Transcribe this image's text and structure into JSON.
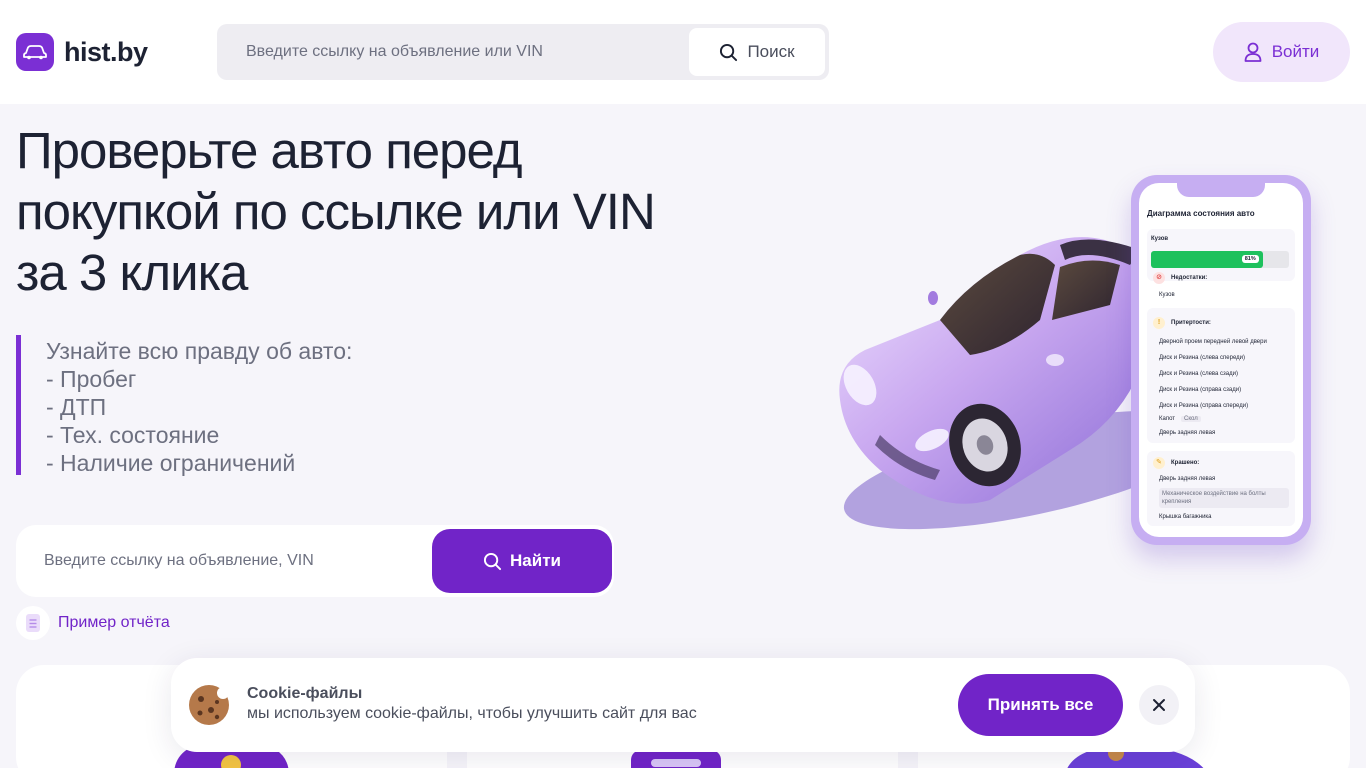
{
  "header": {
    "logo_text": "hist.by",
    "search_placeholder": "Введите ссылку на объявление или VIN",
    "search_button": "Поиск",
    "login_button": "Войти"
  },
  "hero": {
    "title_line1": "Проверьте авто перед",
    "title_line2": "покупкой по ссылке или VIN",
    "title_line3": "за 3 клика",
    "features": [
      "Узнайте всю правду об авто:",
      "- Пробег",
      "- ДТП",
      "- Тех. состояние",
      "- Наличие ограничений"
    ],
    "search_placeholder": "Введите ссылку на объявление, VIN",
    "find_button": "Найти",
    "sample_link": "Пример отчёта"
  },
  "phone": {
    "title": "Диаграмма состояния авто",
    "body_label": "Кузов",
    "body_percent": "81%",
    "body_fraction": 0.81,
    "defects_label": "Недостатки:",
    "defects_items": [
      "Кузов"
    ],
    "wear_label": "Притертости:",
    "wear_items": [
      "Дверной проем передней левой двери",
      "Диск и Резина (слева спереди)",
      "Диск и Резина (слева сзади)",
      "Диск и Резина (справа сзади)",
      "Диск и Резина (справа спереди)",
      "Капот",
      "Дверь задняя левая"
    ],
    "wear_tag": "Скол",
    "paint_label": "Крашено:",
    "paint_items": [
      "Дверь задняя левая",
      "Крышка багажника"
    ],
    "paint_note": "Механическое воздействие на болты крепления"
  },
  "cookie": {
    "title": "Cookie-файлы",
    "text": "мы используем cookie-файлы, чтобы улучшить сайт для вас",
    "accept_button": "Принять все"
  },
  "colors": {
    "accent": "#7124c8",
    "accent_light": "#f1e6fb",
    "text": "#1d2233",
    "muted": "#6d7080",
    "progress": "#1ec15d"
  }
}
